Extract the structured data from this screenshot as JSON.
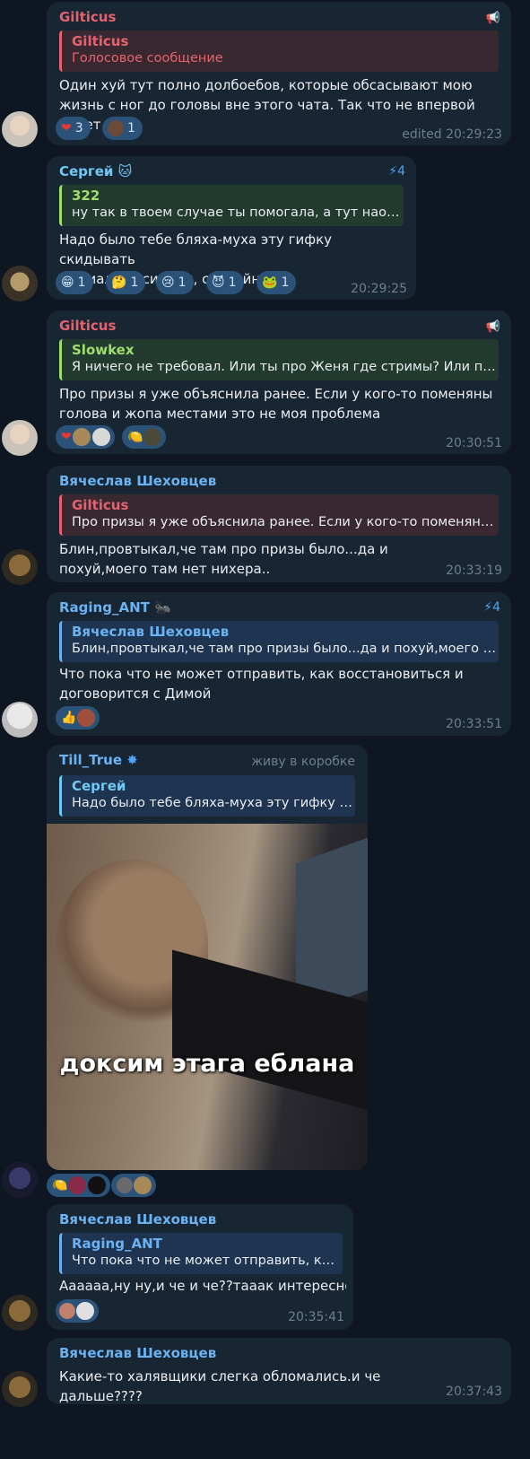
{
  "messages": [
    {
      "author": "Gilticus",
      "reply": {
        "author": "Gilticus",
        "text": "Голосовое сообщение"
      },
      "text": "Один хуй тут полно долбоебов, которые обсасывают мою жизнь с ног до головы вне этого чата. Так что не впервой будет👍🏻",
      "reactions": [
        {
          "emoji": "❤️",
          "count": "3"
        },
        {
          "emoji": "avatar",
          "count": "1"
        }
      ],
      "time": "edited 20:29:23"
    },
    {
      "author": "Сергей",
      "boost": "4",
      "reply": {
        "author": "322",
        "text": "ну так в твоем случае ты помогала, а тут наоборот"
      },
      "text": "Надо было тебе бляха-муха эту гифку скидывать\nНормально сидели, спокойно",
      "reactions": [
        {
          "emoji": "😁",
          "count": "1"
        },
        {
          "emoji": "🤔",
          "count": "1"
        },
        {
          "emoji": "😢",
          "count": "1"
        },
        {
          "emoji": "😈",
          "count": "1"
        },
        {
          "emoji": "🐸",
          "count": "1"
        }
      ],
      "time": "20:29:25"
    },
    {
      "author": "Gilticus",
      "reply": {
        "author": "Slowkex",
        "text": "Я ничего не требовал. Или ты про Женя где стримы? Или про призы"
      },
      "text": "Про призы я уже объяснила ранее. Если у кого-то поменяны голова и жопа местами это не моя проблема",
      "reactions": [
        {
          "emoji": "❤️",
          "count": ""
        },
        {
          "emoji": "🍋",
          "count": ""
        }
      ],
      "time": "20:30:51"
    },
    {
      "author": "Вячеслав Шеховцев",
      "reply": {
        "author": "Gilticus",
        "text": "Про призы я уже объяснила ранее. Если у кого-то поменяны голова"
      },
      "text": "Блин,провтыкал,че там про призы было...да и похуй,моего там нет нихера..",
      "time": "20:33:19"
    },
    {
      "author": "Raging_ANT",
      "boost": "4",
      "reply": {
        "author": "Вячеслав Шеховцев",
        "text": "Блин,провтыкал,че там про призы было...да и похуй,моего там нет"
      },
      "text": "Что пока что не может отправить, как восстановиться и договорится с Димой",
      "reactions": [
        {
          "emoji": "👍",
          "count": ""
        }
      ],
      "time": "20:33:51"
    },
    {
      "author": "Till_True",
      "status": "живу в коробке",
      "reply": {
        "author": "Сергей",
        "text": "Надо было тебе бляха-муха эту гифку скидывать"
      },
      "caption": "доксим этага еблана"
    },
    {
      "author": "Вячеслав Шеховцев",
      "reply": {
        "author": "Raging_ANT",
        "text": "Что пока что не может отправить, как восстановиться"
      },
      "text": "Аааааа,ну ну,и че и че??тааак интересно...",
      "time": "20:35:41"
    },
    {
      "author": "Вячеслав Шеховцев",
      "text": "Какие-то халявщики слегка обломались.и че дальше????",
      "time": "20:37:43"
    }
  ],
  "colors": {
    "background": "#0e1621",
    "bubble": "#182533",
    "reaction": "#2b5278",
    "gilticus": "#e5636f",
    "sergey": "#6ec9f7",
    "green": "#9ede6e",
    "blue": "#6ab3f3",
    "time": "#6d7f8f"
  }
}
